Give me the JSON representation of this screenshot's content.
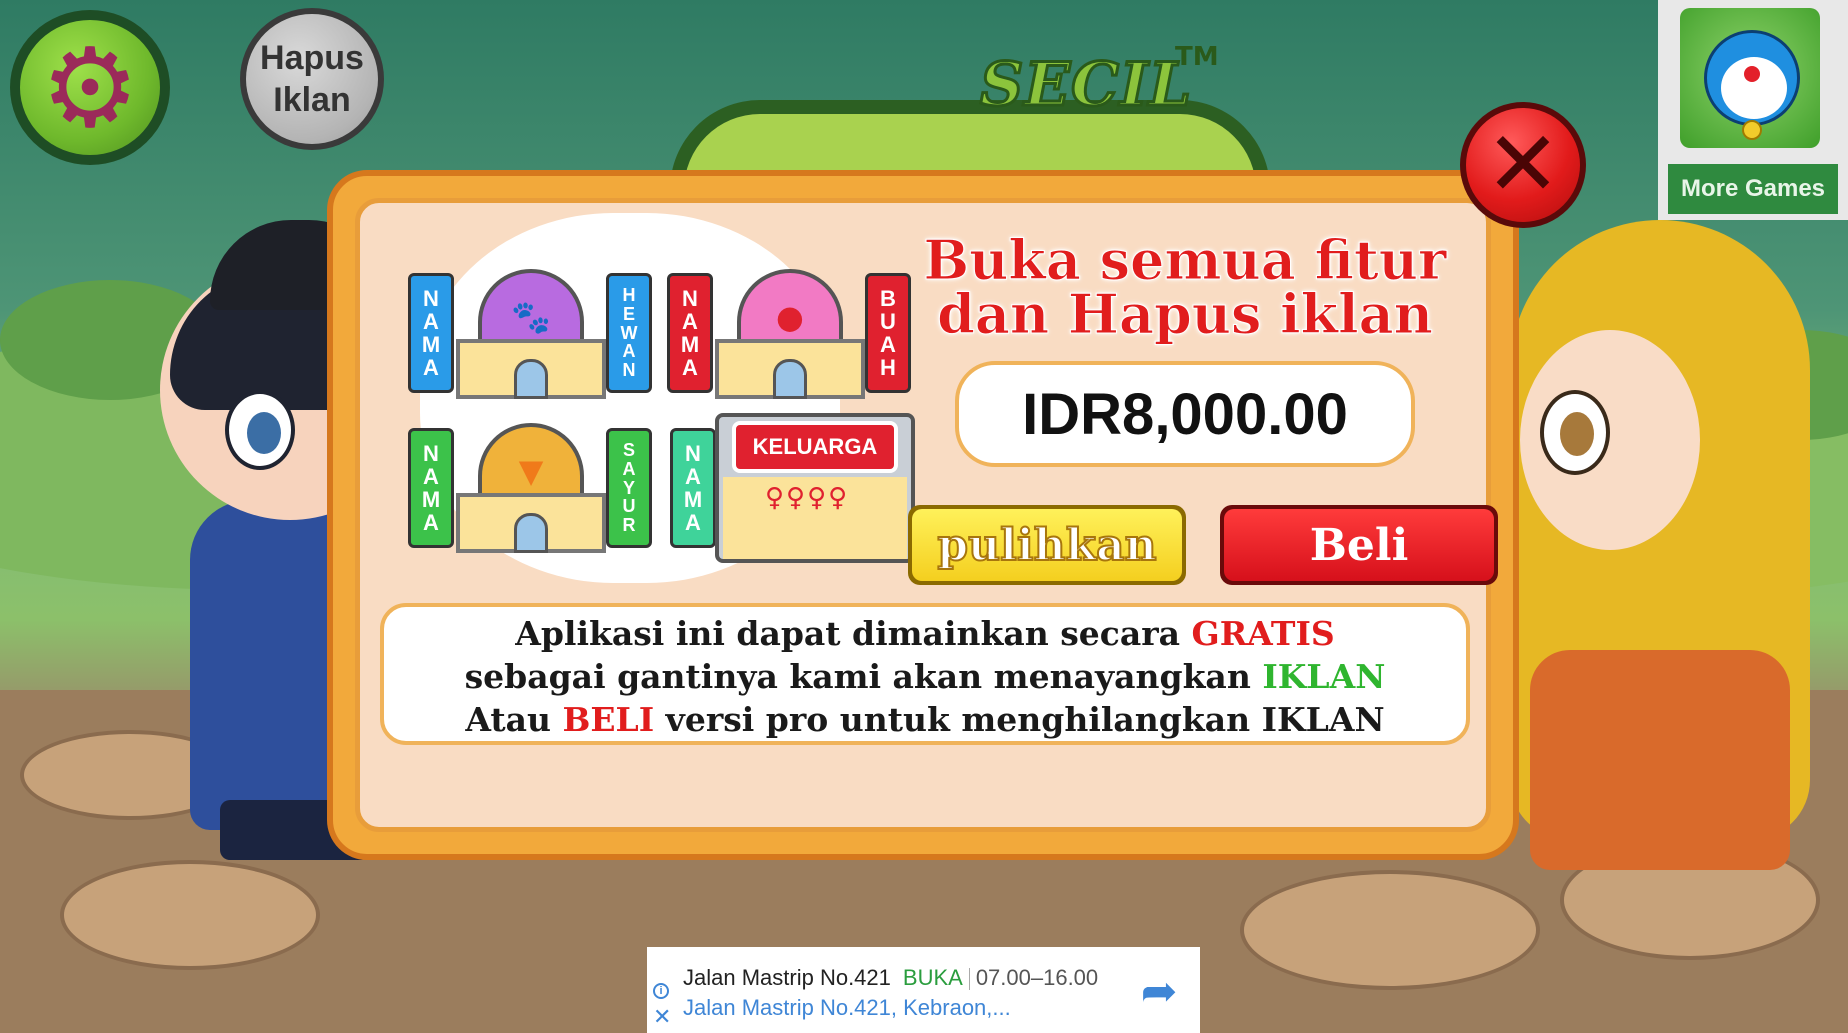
{
  "top_bar": {
    "settings_icon": "gear-icon",
    "hapus_iklan_line1": "Hapus",
    "hapus_iklan_line2": "Iklan"
  },
  "title": {
    "secil": "SECIL",
    "trademark": "TM"
  },
  "more_games": {
    "thumbnail_icon": "doraemon-icon",
    "label": "More Games"
  },
  "dialog": {
    "close_icon": "close-icon",
    "headline_line1": "Buka semua fitur",
    "headline_line2": "dan Hapus iklan",
    "price": "IDR8,000.00",
    "restore_label": "pulihkan",
    "buy_label": "Beli",
    "info": {
      "line1_prefix": "Aplikasi ini dapat dimainkan secara ",
      "line1_highlight": "GRATIS",
      "line2_prefix": "sebagai gantinya kami akan menayangkan ",
      "line2_highlight": "IKLAN",
      "line3_prefix": "Atau ",
      "line3_highlight": "BELI",
      "line3_suffix": " versi pro untuk menghilangkan IKLAN"
    },
    "houses": [
      {
        "left_tag": "NAMA",
        "right_tag": "HEWAN",
        "icon": "paw-icon",
        "tag_color": "#2a9be8",
        "roof_color": "#b86be0"
      },
      {
        "left_tag": "NAMA",
        "right_tag": "BUAH",
        "icon": "apple-icon",
        "tag_color": "#e0212f",
        "roof_color": "#f27ac4"
      },
      {
        "left_tag": "NAMA",
        "right_tag": "SAYUR",
        "icon": "carrot-icon",
        "tag_color": "#3cc24a",
        "roof_color": "#f0b23a"
      },
      {
        "left_tag": "NAMA",
        "sign": "KELUARGA",
        "icon": "family-icon",
        "tag_color": "#3fd39a"
      }
    ]
  },
  "ad": {
    "title": "Jalan Mastrip No.421",
    "status": "BUKA",
    "hours": "07.00–16.00",
    "address": "Jalan Mastrip No.421, Kebraon,...",
    "info_icon": "info-icon",
    "close_icon": "close-icon",
    "directions_icon": "directions-icon"
  },
  "colors": {
    "headline_red": "#e11d1d",
    "highlight_green": "#2fb52f",
    "dialog_orange": "#f2a93b",
    "dialog_cream": "#f9dcc3"
  }
}
